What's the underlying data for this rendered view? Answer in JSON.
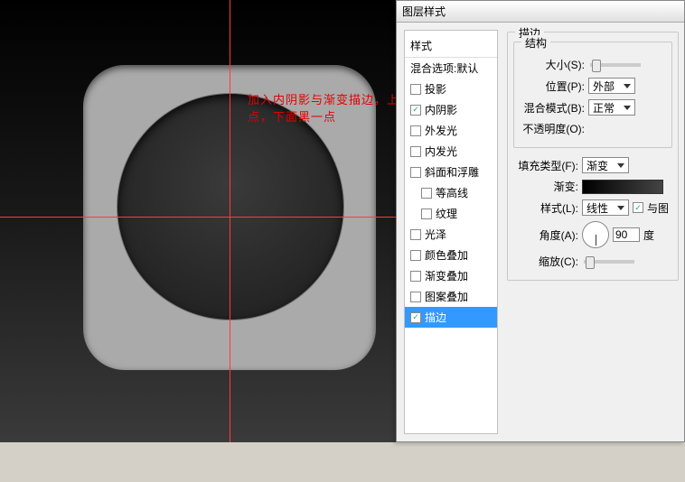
{
  "annotation": "加入内阴影与渐变描边，上面浅一点，下面黑一点",
  "dialog": {
    "title": "图层样式",
    "styles_header": "样式",
    "blend_defaults": "混合选项:默认",
    "items": [
      {
        "label": "投影",
        "checked": false
      },
      {
        "label": "内阴影",
        "checked": true
      },
      {
        "label": "外发光",
        "checked": false
      },
      {
        "label": "内发光",
        "checked": false
      },
      {
        "label": "斜面和浮雕",
        "checked": false
      },
      {
        "label": "等高线",
        "checked": false,
        "indent": true
      },
      {
        "label": "纹理",
        "checked": false,
        "indent": true
      },
      {
        "label": "光泽",
        "checked": false
      },
      {
        "label": "颜色叠加",
        "checked": false
      },
      {
        "label": "渐变叠加",
        "checked": false
      },
      {
        "label": "图案叠加",
        "checked": false
      },
      {
        "label": "描边",
        "checked": true,
        "selected": true
      }
    ]
  },
  "stroke": {
    "group": "描边",
    "struct_group": "结构",
    "size_label": "大小(S):",
    "position_label": "位置(P):",
    "position_value": "外部",
    "blendmode_label": "混合模式(B):",
    "blendmode_value": "正常",
    "opacity_label": "不透明度(O):",
    "filltype_label": "填充类型(F):",
    "filltype_value": "渐变",
    "gradient_label": "渐变:",
    "style_label": "样式(L):",
    "style_value": "线性",
    "align_label": "与图",
    "angle_label": "角度(A):",
    "angle_value": "90",
    "angle_unit": "度",
    "scale_label": "缩放(C):"
  }
}
